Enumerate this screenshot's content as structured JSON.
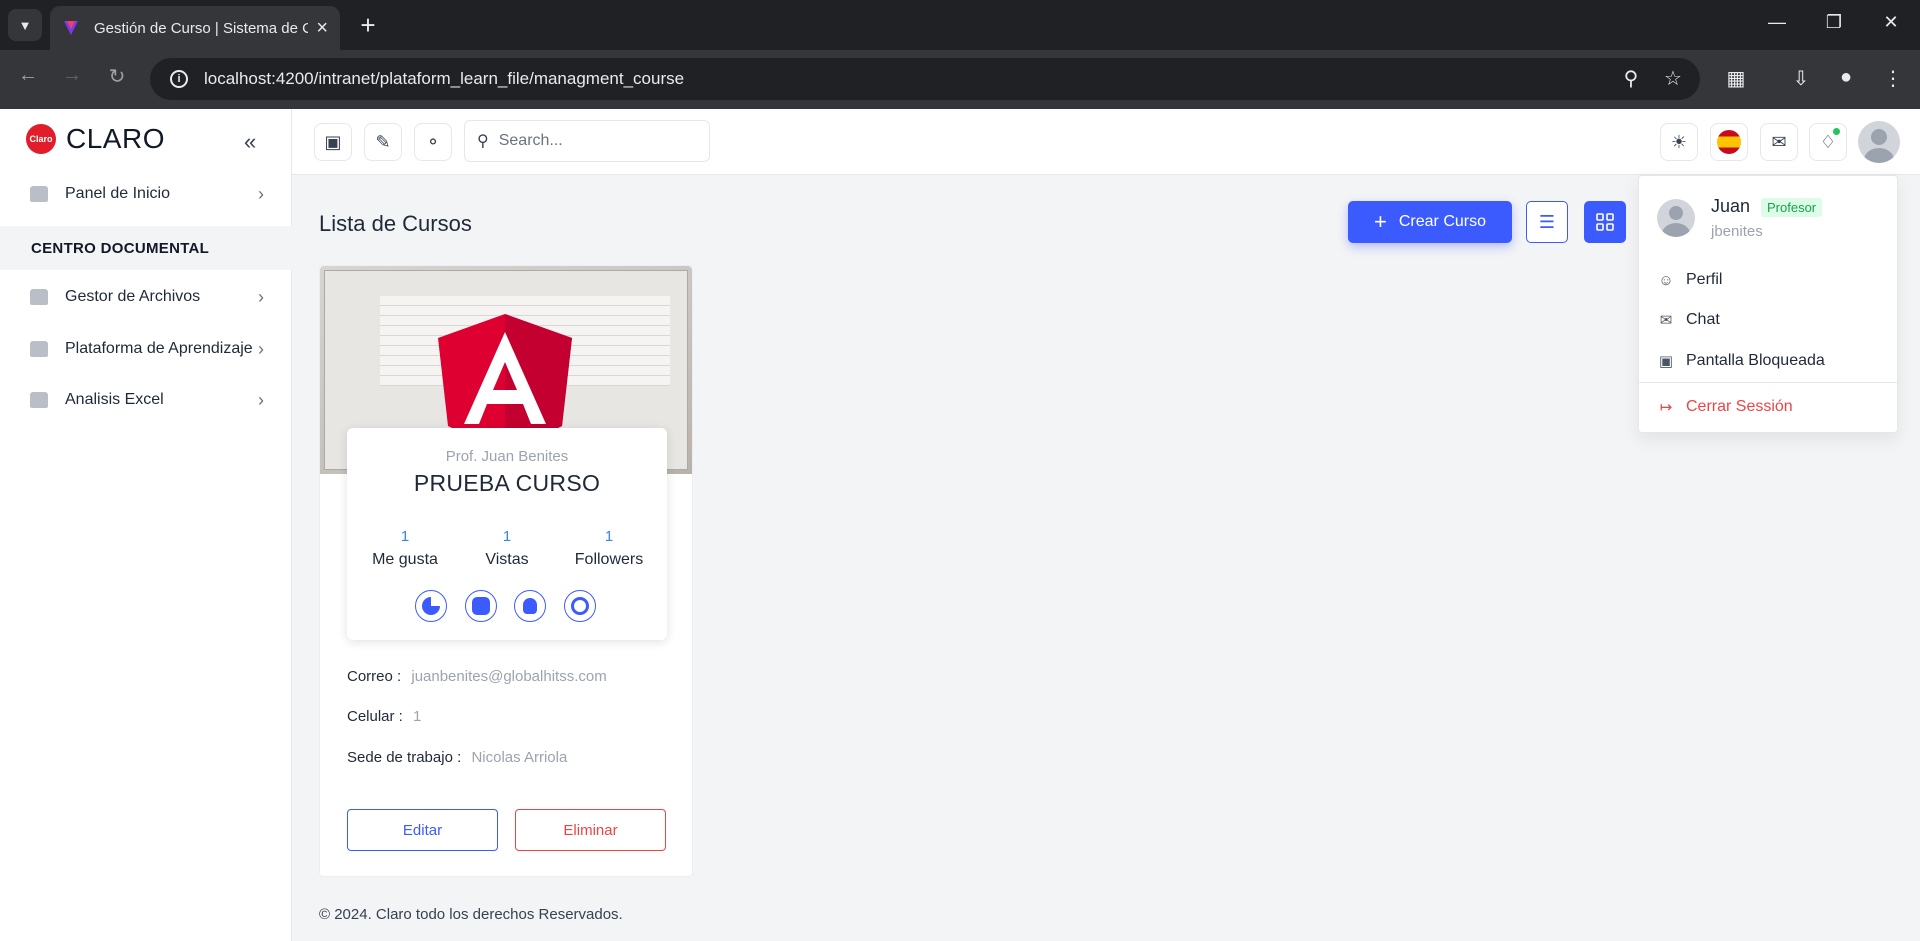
{
  "browser": {
    "tab_title": "Gestión de Curso | Sistema de C",
    "url": "localhost:4200/intranet/plataform_learn_file/managment_course"
  },
  "sidebar": {
    "brand": "CLARO",
    "brand_logo": "Claro",
    "items": [
      {
        "label": "Panel de Inicio"
      },
      {
        "label": "Gestor de Archivos"
      },
      {
        "label": "Plataforma de Aprendizaje"
      },
      {
        "label": "Analisis Excel"
      }
    ],
    "section": "CENTRO DOCUMENTAL"
  },
  "topbar": {
    "search_placeholder": "Search..."
  },
  "main": {
    "title": "Lista de Cursos",
    "create_button": "Crear Curso",
    "course": {
      "professor": "Prof. Juan Benites",
      "name": "PRUEBA CURSO",
      "stats": [
        {
          "value": "1",
          "label": "Me gusta"
        },
        {
          "value": "1",
          "label": "Vistas"
        },
        {
          "value": "1",
          "label": "Followers"
        }
      ],
      "email_label": "Correo :",
      "email": "juanbenites@globalhitss.com",
      "phone_label": "Celular :",
      "phone": "1",
      "site_label": "Sede de trabajo :",
      "site": "Nicolas Arriola",
      "edit_button": "Editar",
      "delete_button": "Eliminar"
    },
    "footer": "© 2024. Claro todo los derechos Reservados."
  },
  "user_menu": {
    "name": "Juan",
    "role": "Profesor",
    "username": "jbenites",
    "items": [
      {
        "label": "Perfil"
      },
      {
        "label": "Chat"
      },
      {
        "label": "Pantalla Bloqueada"
      }
    ],
    "logout": "Cerrar Sessión"
  },
  "colors": {
    "primary": "#3b5bff",
    "danger": "#ef4444",
    "success": "#16a34a",
    "brand": "#e11d2c"
  }
}
